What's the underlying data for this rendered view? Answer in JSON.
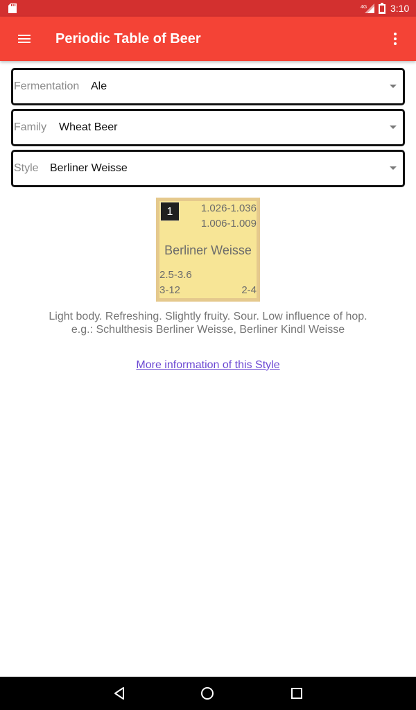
{
  "status_bar": {
    "time": "3:10",
    "network": "4G",
    "icons": [
      "sd-card-icon",
      "signal-icon",
      "battery-icon"
    ]
  },
  "app_bar": {
    "title": "Periodic Table of Beer",
    "icons": [
      "menu-icon",
      "overflow-menu-icon"
    ]
  },
  "filters": {
    "fermentation": {
      "label": "Fermentation",
      "value": "Ale"
    },
    "family": {
      "label": "Family",
      "value": "Wheat Beer"
    },
    "style": {
      "label": "Style",
      "value": "Berliner Weisse"
    }
  },
  "element": {
    "number": "1",
    "og": "1.026-1.036",
    "fg": "1.006-1.009",
    "name": "Berliner Weisse",
    "abv": "2.5-3.6",
    "ibu": "3-12",
    "srm": "2-4"
  },
  "description": "Light body. Refreshing. Slightly fruity. Sour. Low influence of hop.",
  "examples": "e.g.: Schulthesis Berliner Weisse, Berliner Kindl Weisse",
  "more_link": "More information of this Style",
  "colors": {
    "status_bar": "#d3302f",
    "app_bar": "#f44336",
    "tile_fill": "#f7e596",
    "tile_border": "#e5c98d",
    "link": "#6b48d3"
  },
  "nav_bar": {
    "icons": [
      "back-icon",
      "home-icon",
      "recents-icon"
    ]
  }
}
